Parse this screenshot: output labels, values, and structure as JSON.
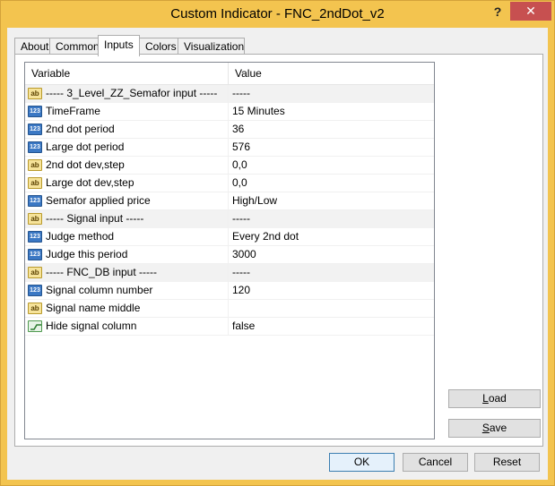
{
  "window": {
    "title": "Custom Indicator - FNC_2ndDot_v2",
    "help_label": "?",
    "close_label": "✕"
  },
  "tabs": [
    {
      "label": "About"
    },
    {
      "label": "Common"
    },
    {
      "label": "Inputs"
    },
    {
      "label": "Colors"
    },
    {
      "label": "Visualization"
    }
  ],
  "active_tab": "Inputs",
  "grid": {
    "col_variable": "Variable",
    "col_value": "Value",
    "rows": [
      {
        "type": "ab",
        "variable": "----- 3_Level_ZZ_Semafor input -----",
        "value": "-----"
      },
      {
        "type": "123",
        "variable": "TimeFrame",
        "value": "15 Minutes"
      },
      {
        "type": "123",
        "variable": "2nd dot period",
        "value": "36"
      },
      {
        "type": "123",
        "variable": "Large dot period",
        "value": "576"
      },
      {
        "type": "ab",
        "variable": "2nd dot dev,step",
        "value": "0,0"
      },
      {
        "type": "ab",
        "variable": "Large dot dev,step",
        "value": "0,0"
      },
      {
        "type": "123",
        "variable": "Semafor applied price",
        "value": "High/Low"
      },
      {
        "type": "ab",
        "variable": "----- Signal input -----",
        "value": "-----"
      },
      {
        "type": "123",
        "variable": "Judge method",
        "value": "Every 2nd dot"
      },
      {
        "type": "123",
        "variable": "Judge this period",
        "value": "3000"
      },
      {
        "type": "ab",
        "variable": "----- FNC_DB input -----",
        "value": "-----"
      },
      {
        "type": "123",
        "variable": "Signal column number",
        "value": "120"
      },
      {
        "type": "ab",
        "variable": "Signal name middle",
        "value": ""
      },
      {
        "type": "bool",
        "variable": "Hide signal column",
        "value": "false"
      }
    ]
  },
  "icons": {
    "ab": "ab",
    "123": "123"
  },
  "buttons": {
    "load_first": "L",
    "load_rest": "oad",
    "save_first": "S",
    "save_rest": "ave",
    "ok": "OK",
    "cancel": "Cancel",
    "reset": "Reset"
  }
}
